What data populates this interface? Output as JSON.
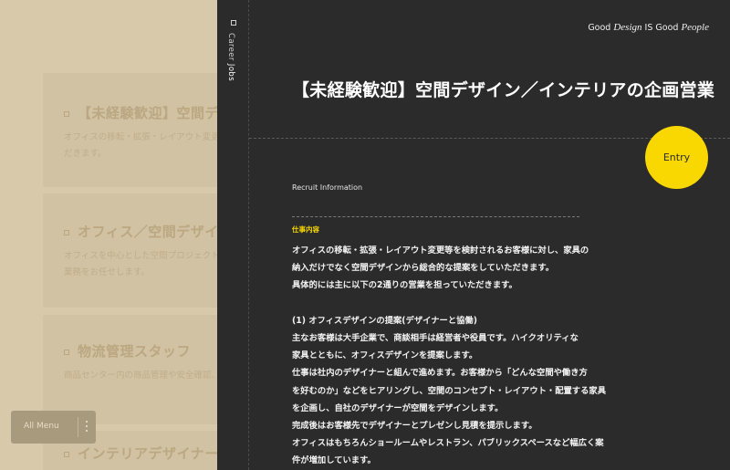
{
  "background": {
    "jobs": [
      {
        "title": "【未経験歓迎】空間デザイ",
        "desc": [
          "オフィスの移転・拡張・レイアウト変更等を",
          "だきます。"
        ]
      },
      {
        "title": "オフィス／空間デザインの",
        "desc": [
          "オフィスを中心とした空間プロジェクトに",
          "業務をお任せします。"
        ]
      },
      {
        "title": "物流管理スタッフ",
        "desc": [
          "商品センター内の商品管理や安全確認、"
        ]
      },
      {
        "title": "インテリアデザイナー",
        "desc": []
      }
    ],
    "all_menu_label": "All Menu"
  },
  "panel": {
    "rail": {
      "prefix": "Career ",
      "current": "Jobs"
    },
    "tagline": {
      "pre": "Good ",
      "design": "Design",
      "mid": " IS Good ",
      "people": "People"
    },
    "job_title": "【未経験歓迎】空間デザイン／インテリアの企画営業",
    "entry_label": "Entry",
    "section_label": "Recruit Information",
    "sub_label": "仕事内容",
    "body_lines": [
      "オフィスの移転・拡張・レイアウト変更等を検討されるお客様に対し、家具の",
      "納入だけでなく空間デザインから総合的な提案をしていただきます。",
      "具体的には主に以下の2通りの営業を担っていただきます。",
      "",
      "(1) オフィスデザインの提案(デザイナーと協働)",
      "主なお客様は大手企業で、商談相手は経営者や役員です。ハイクオリティな",
      "家具とともに、オフィスデザインを提案します。",
      "仕事は社内のデザイナーと組んで進めます。お客様から「どんな空間や働き方",
      "を好むのか」などをヒアリングし、空間のコンセプト・レイアウト・配置する家具",
      "を企画し、自社のデザイナーが空間をデザインします。",
      "完成後はお客様先でデザイナーとプレゼンし見積を提示します。",
      "オフィスはもちろんショールームやレストラン、パブリックスペースなど幅広く案",
      "件が増加しています。"
    ]
  }
}
